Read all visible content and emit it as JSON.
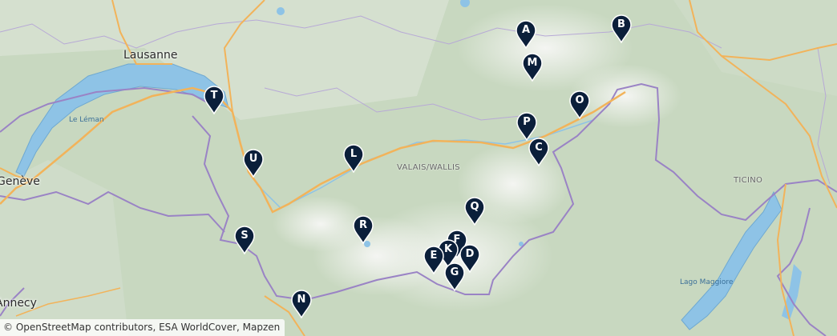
{
  "map": {
    "places": [
      {
        "label": "Lausanne",
        "kind": "city"
      },
      {
        "label": "Genève",
        "kind": "city"
      },
      {
        "label": "Annecy",
        "kind": "city"
      },
      {
        "label": "VALAIS/WALLIS",
        "kind": "region"
      },
      {
        "label": "TICINO",
        "kind": "region"
      },
      {
        "label": "Le Léman",
        "kind": "lake"
      },
      {
        "label": "Lago Maggiore",
        "kind": "lake"
      }
    ],
    "markers": [
      "A",
      "B",
      "M",
      "O",
      "T",
      "P",
      "C",
      "L",
      "U",
      "Q",
      "R",
      "S",
      "F",
      "K",
      "D",
      "E",
      "G",
      "N"
    ],
    "marker_color": "#0b1f3a",
    "attribution": "© OpenStreetMap contributors, ESA WorldCover, Mapzen"
  }
}
